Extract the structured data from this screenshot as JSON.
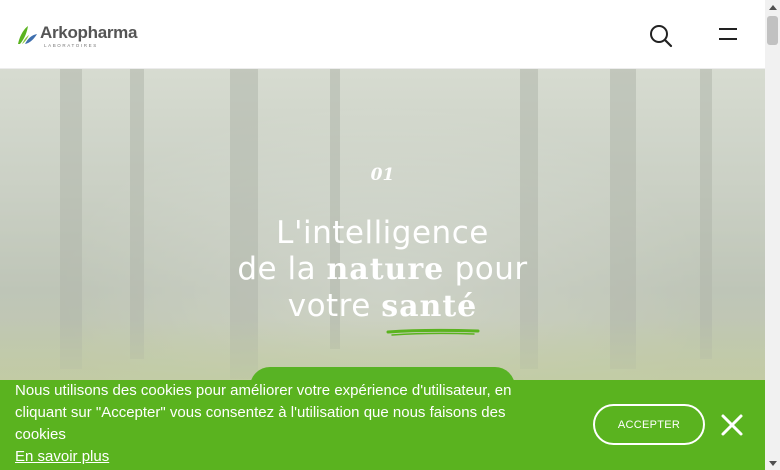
{
  "brand": {
    "name": "Arkopharma",
    "subtitle": "LABORATOIRES",
    "accent_color": "#5ab31f",
    "leaf_colors": [
      "#5ab31f",
      "#3f6fae"
    ]
  },
  "header": {
    "search_icon": "search-icon",
    "menu_icon": "hamburger-menu-icon"
  },
  "hero": {
    "slide_number": "01",
    "headline": {
      "line1": "L'intelligence",
      "line2_prefix": "de la ",
      "line2_emphasis": "nature",
      "line2_suffix": " pour",
      "line3_prefix": "votre ",
      "line3_emphasis": "santé"
    }
  },
  "cookie_banner": {
    "message": "Nous utilisons des cookies pour améliorer votre expérience d'utilisateur, en cliquant sur \"Accepter\" vous consentez à l'utilisation que nous faisons des cookies",
    "learn_more": "En savoir plus",
    "accept_label": "ACCEPTER",
    "close_icon": "close-icon"
  }
}
